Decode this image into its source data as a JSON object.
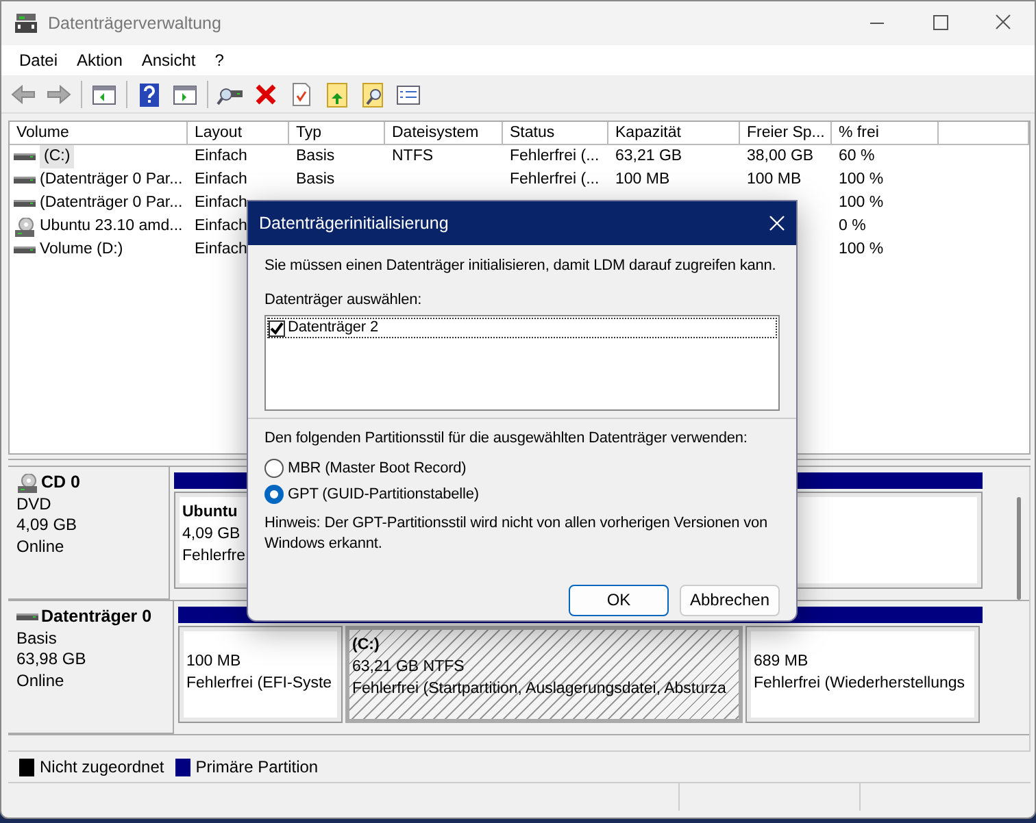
{
  "window": {
    "title": "Datenträgerverwaltung"
  },
  "menu": [
    "Datei",
    "Aktion",
    "Ansicht",
    "?"
  ],
  "volume_list": {
    "columns": [
      "Volume",
      "Layout",
      "Typ",
      "Dateisystem",
      "Status",
      "Kapazität",
      "Freier Sp...",
      "% frei"
    ],
    "rows": [
      {
        "kind": "drive",
        "selected": true,
        "volume": "(C:)",
        "layout": "Einfach",
        "typ": "Basis",
        "dateisystem": "NTFS",
        "status": "Fehlerfrei (...",
        "kapazitaet": "63,21 GB",
        "frei": "38,00 GB",
        "prozent": "60 %"
      },
      {
        "kind": "drive",
        "selected": false,
        "volume": "(Datenträger 0 Par...",
        "layout": "Einfach",
        "typ": "Basis",
        "status": "Fehlerfrei (...",
        "kapazitaet": "100 MB",
        "frei": "100 MB",
        "prozent": "100 %"
      },
      {
        "kind": "drive",
        "selected": false,
        "volume": "(Datenträger 0 Par...",
        "layout": "Einfach",
        "prozent": "100 %"
      },
      {
        "kind": "cd",
        "selected": false,
        "volume": "Ubuntu 23.10 amd...",
        "layout": "Einfach",
        "prozent": "0 %"
      },
      {
        "kind": "drive",
        "selected": false,
        "volume": "Volume (D:)",
        "layout": "Einfach",
        "prozent": "100 %"
      }
    ]
  },
  "disk_view": {
    "disks": [
      {
        "kind": "cd",
        "name": "CD 0",
        "type": "DVD",
        "size": "4,09 GB",
        "state": "Online",
        "partitions": [
          {
            "label": "Ubuntu",
            "size": "4,09 GB",
            "status": "Fehlerfre",
            "selected": false
          }
        ]
      },
      {
        "kind": "drive",
        "name": "Datenträger 0",
        "type": "Basis",
        "size": "63,98 GB",
        "state": "Online",
        "partitions": [
          {
            "size": "100 MB",
            "status": "Fehlerfrei (EFI-Syste",
            "selected": false
          },
          {
            "label": "(C:)",
            "size": "63,21 GB NTFS",
            "status": "Fehlerfrei (Startpartition, Auslagerungsdatei, Absturza",
            "selected": true
          },
          {
            "size": "689 MB",
            "status": "Fehlerfrei (Wiederherstellungs",
            "selected": false
          }
        ]
      }
    ]
  },
  "legend": [
    {
      "label": "Nicht zugeordnet",
      "color": "#000000"
    },
    {
      "label": "Primäre Partition",
      "color": "#000080"
    }
  ],
  "dialog": {
    "title": "Datenträgerinitialisierung",
    "intro": "Sie müssen einen Datenträger initialisieren, damit LDM darauf zugreifen kann.",
    "select_label": "Datenträger auswählen:",
    "disks": [
      {
        "label": "Datenträger 2",
        "checked": true
      }
    ],
    "style_label": "Den folgenden Partitionsstil für die ausgewählten Datenträger verwenden:",
    "styles": [
      {
        "label": "MBR (Master Boot Record)",
        "selected": false
      },
      {
        "label": "GPT (GUID-Partitionstabelle)",
        "selected": true
      }
    ],
    "note": "Hinweis: Der GPT-Partitionsstil wird nicht von allen vorherigen Versionen von Windows erkannt.",
    "buttons": [
      {
        "label": "OK",
        "default": true
      },
      {
        "label": "Abbrechen",
        "default": false
      }
    ]
  }
}
